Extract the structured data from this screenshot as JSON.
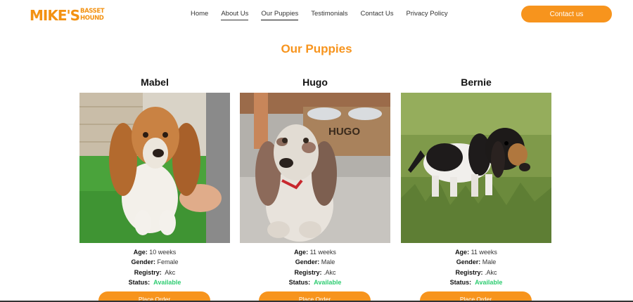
{
  "logo": {
    "main": "MIKE'S",
    "sub1": "BASSET",
    "sub2": "HOUND"
  },
  "nav": {
    "items": [
      {
        "label": "Home"
      },
      {
        "label": "About Us"
      },
      {
        "label": "Our Puppies"
      },
      {
        "label": "Testimonials"
      },
      {
        "label": "Contact Us"
      },
      {
        "label": "Privacy Policy"
      }
    ],
    "active": "Our Puppies"
  },
  "contact_button": "Contact us",
  "section_title": "Our Puppies",
  "labels": {
    "age": "Age:",
    "gender": "Gender:",
    "registry": "Registry:",
    "status": "Status:"
  },
  "puppies": [
    {
      "name": "Mabel",
      "age": "10 weeks",
      "gender": "Female",
      "registry": "Akc",
      "status": "Available",
      "order_label": "Place Order"
    },
    {
      "name": "Hugo",
      "age": "11 weeks",
      "gender": "Male",
      "registry": ".Akc",
      "status": "Available",
      "order_label": "Place Order"
    },
    {
      "name": "Bernie",
      "age": "11 weeks",
      "gender": "Male",
      "registry": ".Akc",
      "status": "Available",
      "order_label": "Place Order"
    }
  ],
  "photo_text": {
    "bowl_label": "HUGO"
  },
  "colors": {
    "brand_orange": "#f7941d",
    "available_green": "#2ecc71"
  }
}
